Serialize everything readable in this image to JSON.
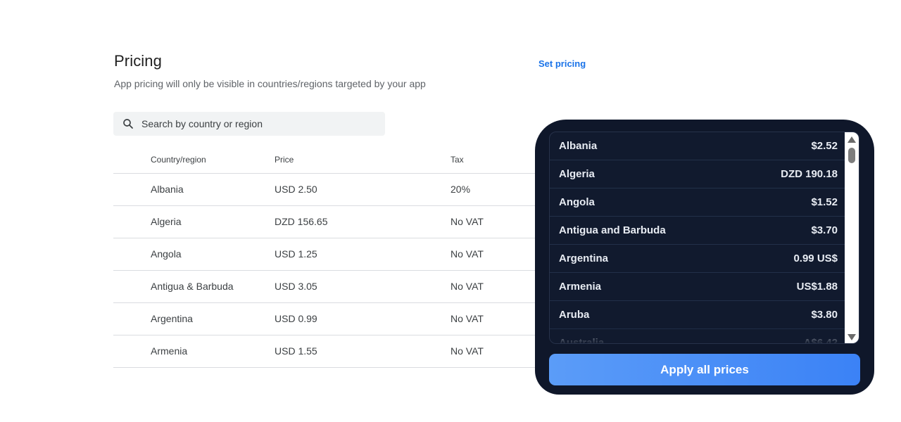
{
  "header": {
    "title": "Pricing",
    "subtitle": "App pricing will only be visible in countries/regions targeted by your app",
    "set_pricing_label": "Set pricing"
  },
  "search": {
    "placeholder": "Search by country or region",
    "value": ""
  },
  "table": {
    "columns": [
      "Country/region",
      "Price",
      "Tax"
    ],
    "rows": [
      {
        "country": "Albania",
        "price": "USD 2.50",
        "tax": "20%"
      },
      {
        "country": "Algeria",
        "price": "DZD 156.65",
        "tax": "No VAT"
      },
      {
        "country": "Angola",
        "price": "USD 1.25",
        "tax": "No VAT"
      },
      {
        "country": "Antigua & Barbuda",
        "price": "USD 3.05",
        "tax": "No VAT"
      },
      {
        "country": "Argentina",
        "price": "USD 0.99",
        "tax": "No VAT"
      },
      {
        "country": "Armenia",
        "price": "USD 1.55",
        "tax": "No VAT"
      }
    ]
  },
  "panel": {
    "items": [
      {
        "country": "Albania",
        "price": "$2.52"
      },
      {
        "country": "Algeria",
        "price": "DZD 190.18"
      },
      {
        "country": "Angola",
        "price": "$1.52"
      },
      {
        "country": "Antigua and Barbuda",
        "price": "$3.70"
      },
      {
        "country": "Argentina",
        "price": "0.99 US$"
      },
      {
        "country": "Armenia",
        "price": "US$1.88"
      },
      {
        "country": "Aruba",
        "price": "$3.80"
      },
      {
        "country": "Australia",
        "price": "A$6.42"
      }
    ],
    "apply_label": "Apply all prices"
  },
  "colors": {
    "link": "#1a73e8",
    "panel_bg": "#0f172a",
    "button_start": "#5b9cf8",
    "button_end": "#3b82f6"
  }
}
